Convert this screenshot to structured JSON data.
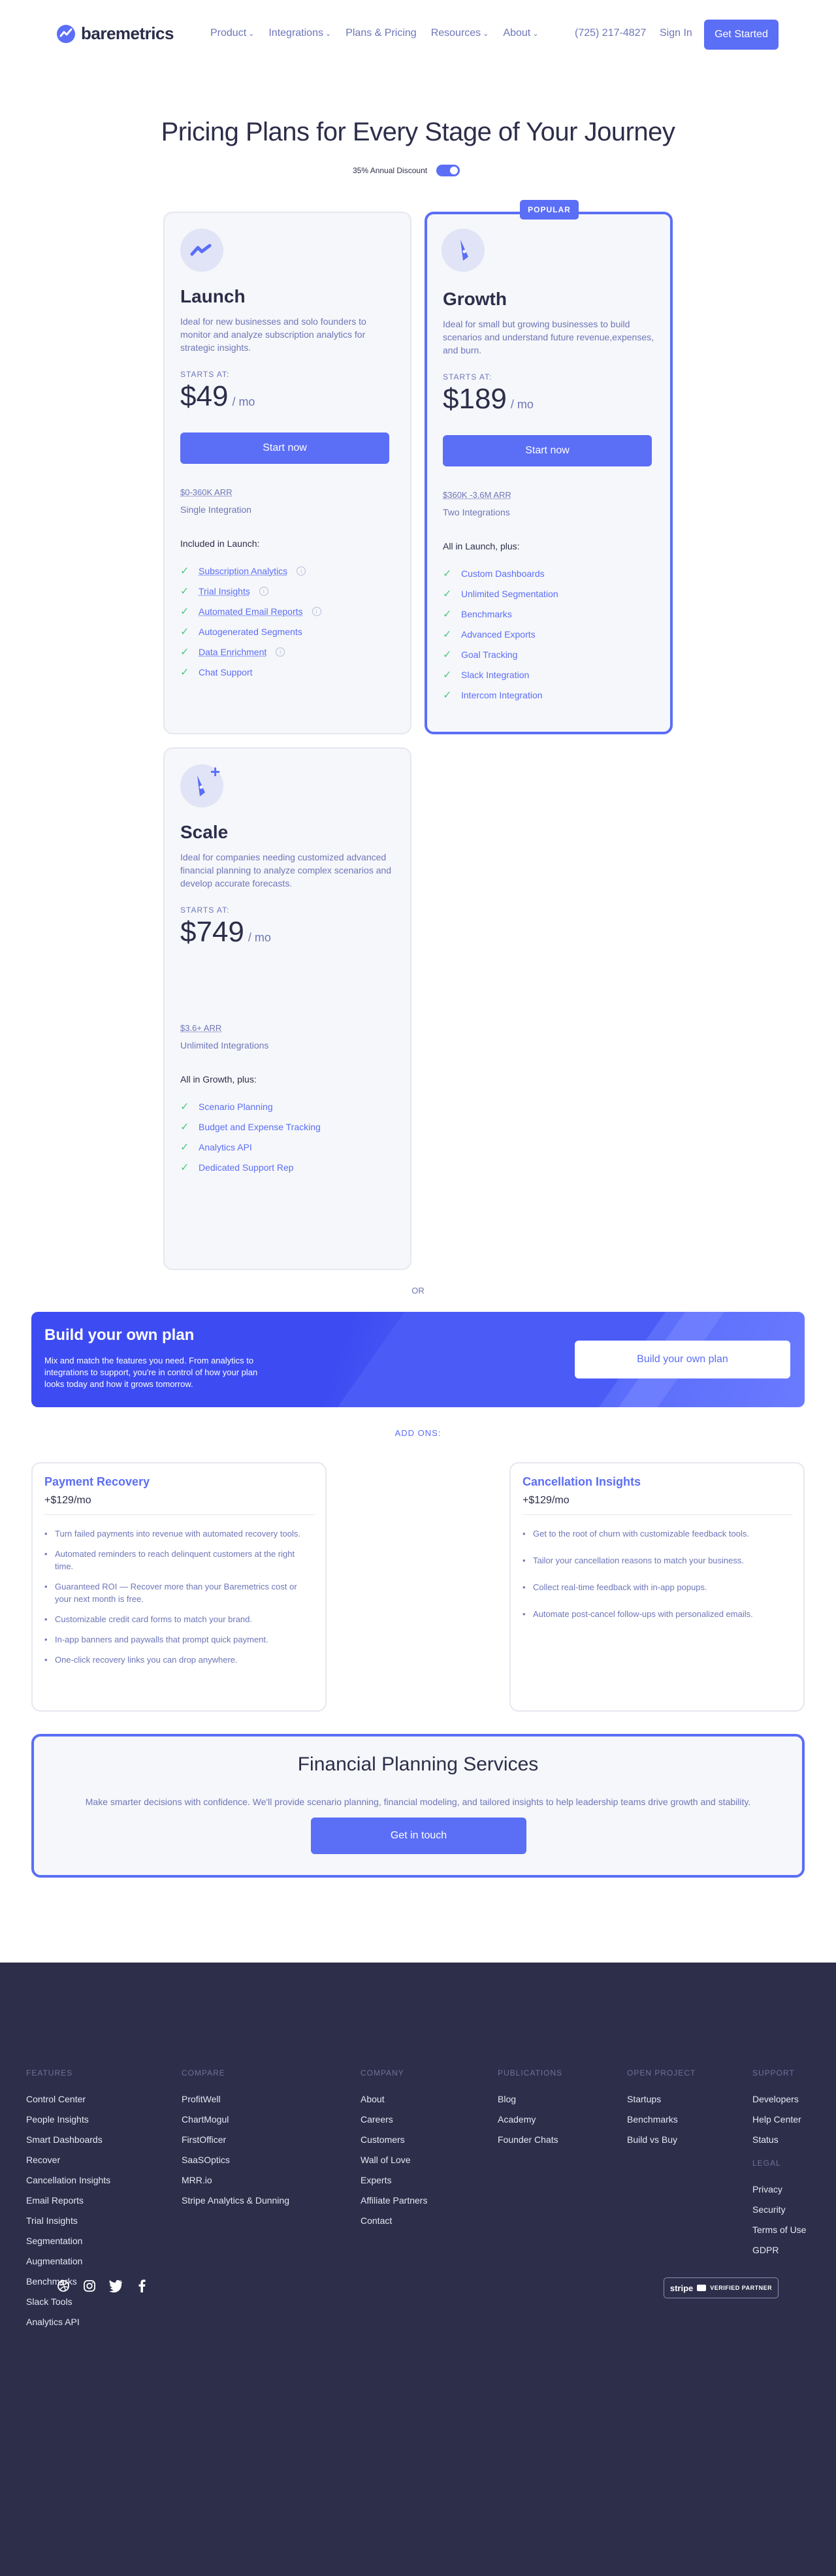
{
  "nav": {
    "brand": "baremetrics",
    "links": [
      {
        "label": "Product",
        "dropdown": true
      },
      {
        "label": "Integrations",
        "dropdown": true
      },
      {
        "label": "Plans & Pricing",
        "dropdown": false
      },
      {
        "label": "Resources",
        "dropdown": true
      },
      {
        "label": "About",
        "dropdown": true
      }
    ],
    "phone": "(725) 217-4827",
    "sign_in": "Sign In",
    "get_started": "Get Started"
  },
  "hero": {
    "title": "Pricing Plans for Every Stage of Your Journey",
    "discount_label": "35% Annual Discount",
    "discount_on": true
  },
  "plans": [
    {
      "name": "Launch",
      "description": "Ideal for new businesses and solo founders to monitor and analyze subscription analytics for strategic insights.",
      "starts_at": "STARTS AT:",
      "currency": "$",
      "price": "49",
      "per": "/ mo",
      "cta": "Start now",
      "arr": "$0-360K ARR",
      "integrations": "Single Integration",
      "included_label": "Included in Launch:",
      "features": [
        {
          "label": "Subscription Analytics",
          "info": true,
          "underline": true
        },
        {
          "label": "Trial Insights",
          "info": true,
          "underline": true
        },
        {
          "label": "Automated Email Reports",
          "info": true,
          "underline": true
        },
        {
          "label": "Autogenerated Segments",
          "info": false,
          "underline": false
        },
        {
          "label": "Data Enrichment",
          "info": true,
          "underline": true
        },
        {
          "label": "Chat Support",
          "info": false,
          "underline": false
        }
      ]
    },
    {
      "name": "Growth",
      "badge": "POPULAR",
      "description": "Ideal for small but growing businesses to build scenarios and understand future revenue,expenses, and burn.",
      "starts_at": "STARTS AT:",
      "currency": "$",
      "price": "189",
      "per": "/ mo",
      "cta": "Start now",
      "arr": "$360K -3.6M ARR",
      "integrations": "Two Integrations",
      "included_label": "All in Launch, plus:",
      "features": [
        {
          "label": "Custom Dashboards"
        },
        {
          "label": "Unlimited Segmentation"
        },
        {
          "label": "Benchmarks"
        },
        {
          "label": "Advanced Exports"
        },
        {
          "label": "Goal Tracking"
        },
        {
          "label": "Slack Integration"
        },
        {
          "label": "Intercom Integration"
        }
      ]
    },
    {
      "name": "Scale",
      "description": "Ideal for companies needing customized advanced financial planning to analyze complex scenarios and develop accurate forecasts.",
      "starts_at": "STARTS AT:",
      "currency": "$",
      "price": "749",
      "per": "/ mo",
      "arr": "$3.6+ ARR",
      "integrations": "Unlimited Integrations",
      "included_label": "All in Growth, plus:",
      "features": [
        {
          "label": "Scenario Planning"
        },
        {
          "label": "Budget and Expense Tracking"
        },
        {
          "label": "Analytics API"
        },
        {
          "label": "Dedicated Support Rep"
        }
      ]
    }
  ],
  "or_label": "OR",
  "build_plan": {
    "title": "Build your own plan",
    "text": "Mix and match the features you need. From analytics to integrations to support, you're in control of how your plan looks today and how it grows tomorrow.",
    "cta": "Build your own plan"
  },
  "addons": {
    "label": "ADD ONS:",
    "items": [
      {
        "title": "Payment Recovery",
        "price": "+$129/mo",
        "bullets": [
          "Turn failed payments into revenue with automated recovery tools.",
          "Automated reminders to reach delinquent customers at the right time.",
          "Guaranteed ROI — Recover more than your Baremetrics cost or your next month is free.",
          "Customizable credit card forms to match your brand.",
          "In-app banners and paywalls that prompt quick payment.",
          "One-click recovery links you can drop anywhere."
        ]
      },
      {
        "title": "Cancellation Insights",
        "price": "+$129/mo",
        "bullets": [
          "Get to the root of churn with customizable feedback tools.",
          "Tailor your cancellation reasons to match your business.",
          "Collect real-time feedback with in-app popups.",
          "Automate post-cancel follow-ups with personalized emails."
        ]
      }
    ]
  },
  "financial_planning": {
    "title": "Financial Planning Services",
    "text": "Make smarter decisions with confidence. We'll provide scenario planning, financial modeling, and tailored insights to help leadership teams drive growth and stability.",
    "cta": "Get in touch"
  },
  "footer": {
    "columns": [
      {
        "heading": "FEATURES",
        "links": [
          "Control Center",
          "People Insights",
          "Smart Dashboards",
          "Recover",
          "Cancellation Insights",
          "Email Reports",
          "Trial Insights",
          "Segmentation",
          "Augmentation",
          "Benchmarks",
          "Slack Tools",
          "Analytics API"
        ]
      },
      {
        "heading": "COMPARE",
        "links": [
          "ProfitWell",
          "ChartMogul",
          "FirstOfficer",
          "SaaSOptics",
          "MRR.io",
          "Stripe Analytics & Dunning"
        ]
      },
      {
        "heading": "COMPANY",
        "links": [
          "About",
          "Careers",
          "Customers",
          "Wall of Love",
          "Experts",
          "Affiliate Partners",
          "Contact"
        ]
      },
      {
        "heading": "PUBLICATIONS",
        "links": [
          "Blog",
          "Academy",
          "Founder Chats"
        ]
      },
      {
        "heading": "OPEN PROJECT",
        "links": [
          "Startups",
          "Benchmarks",
          "Build vs Buy"
        ]
      },
      {
        "heading": "SUPPORT",
        "links": [
          "Developers",
          "Help Center",
          "Status"
        ]
      }
    ],
    "legal": {
      "heading": "LEGAL",
      "links": [
        "Privacy",
        "Security",
        "Terms of Use",
        "GDPR"
      ]
    },
    "socials": [
      "dribbble-icon",
      "instagram-icon",
      "twitter-icon",
      "facebook-icon"
    ],
    "stripe_badge": {
      "brand": "stripe",
      "label": "VERIFIED PARTNER"
    }
  },
  "colors": {
    "accent": "#5b6ef6",
    "text": "#2c2e4a",
    "muted": "#6e76b8",
    "check": "#4fc783",
    "footer_bg": "#2c2e4a"
  }
}
